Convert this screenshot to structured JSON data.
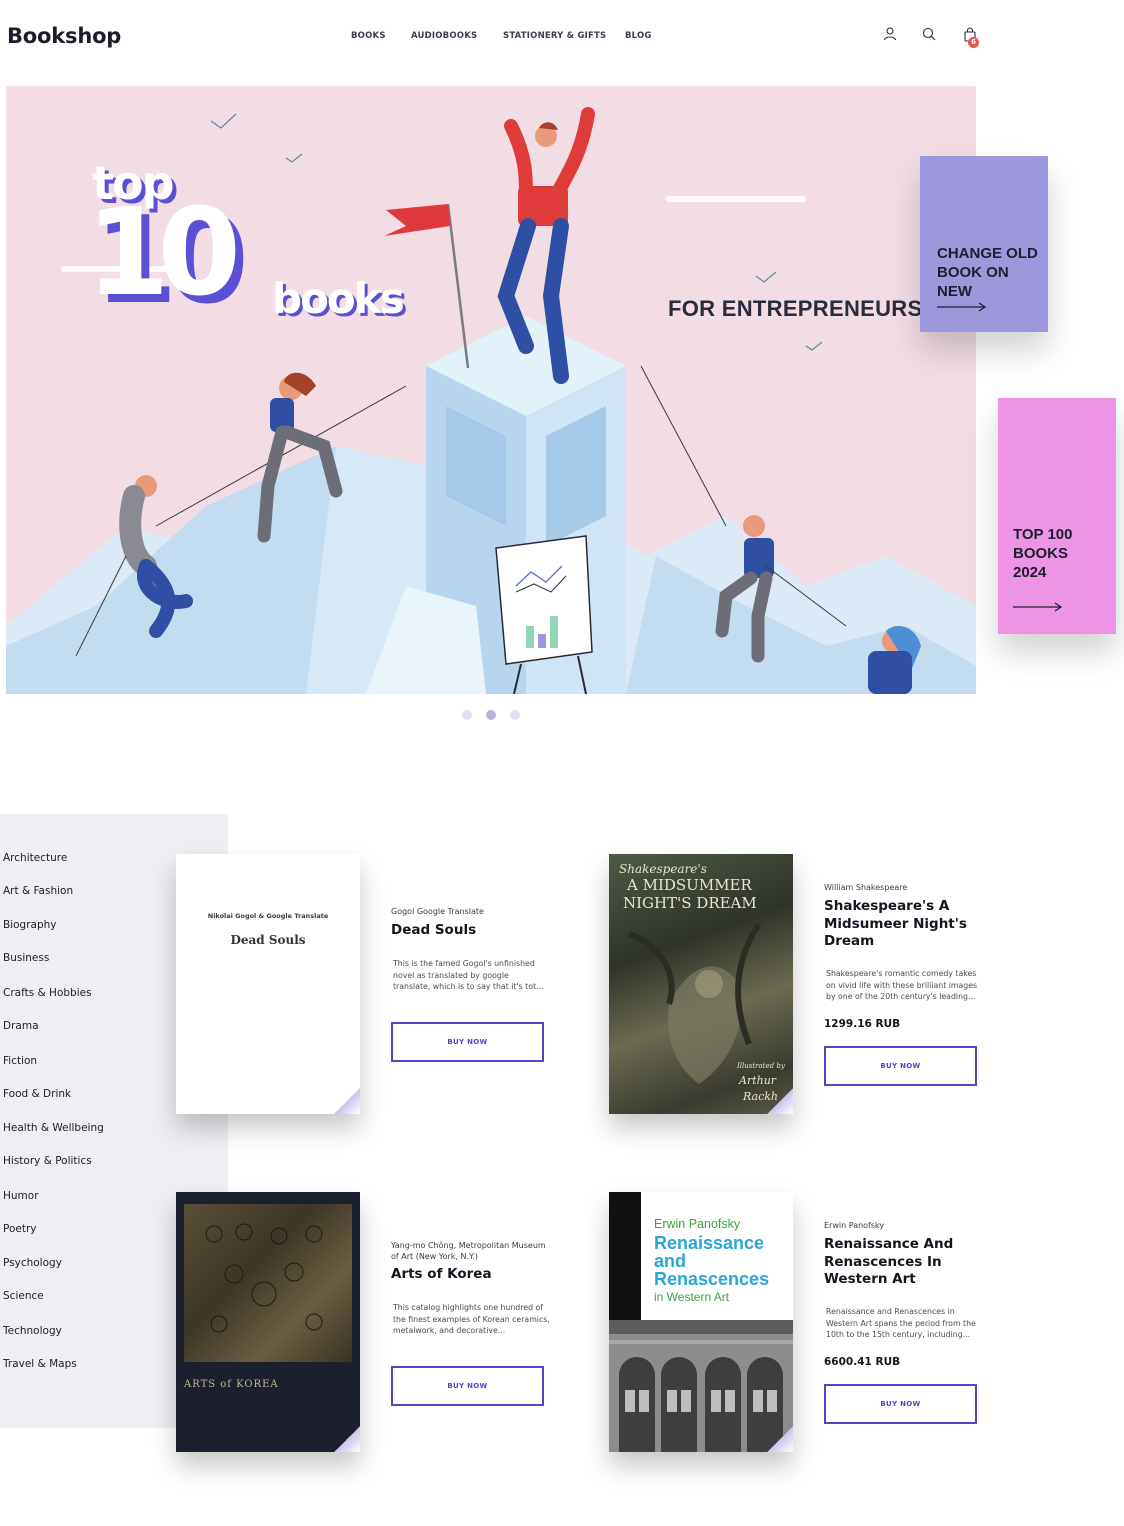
{
  "header": {
    "logo": "Bookshop",
    "nav": [
      "BOOKS",
      "AUDIOBOOKS",
      "STATIONERY & GIFTS",
      "BLOG"
    ],
    "cart_count": "6",
    "icons": [
      "user-icon",
      "search-icon",
      "shopping-bag-icon"
    ]
  },
  "hero": {
    "top": "top",
    "ten": "10",
    "books": "books",
    "subtitle": "FOR ENTREPRENEURS",
    "dots_count": 3,
    "active_dot": 1
  },
  "promos": [
    {
      "text": "CHANGE OLD BOOK ON NEW",
      "color": "#9d97dc"
    },
    {
      "text": "TOP 100 BOOKS 2024",
      "color": "#ee94e4"
    }
  ],
  "categories": [
    "Architecture",
    "Art & Fashion",
    "Biography",
    "Business",
    "Crafts & Hobbies",
    "Drama",
    "Fiction",
    "Food & Drink",
    "Health & Wellbeing",
    "History & Politics",
    "Humor",
    "Poetry",
    "Psychology",
    "Science",
    "Technology",
    "Travel & Maps"
  ],
  "products": [
    {
      "author": "Gogol Google Translate",
      "title": "Dead Souls",
      "description": "This is the famed Gogol's unfinished novel as translated by google translate, which is to say that it's tot...",
      "price": "",
      "button": "BUY NOW",
      "cover_author": "Nikolai Gogol & Google Translate",
      "cover_title": "Dead Souls"
    },
    {
      "author": "William Shakespeare",
      "title": "Shakespeare's A Midsumeer Night's Dream",
      "description": "Shakespeare's romantic comedy takes on vivid life with these brilliant images by one of the 20th century's leading...",
      "price": "1299.16 RUB",
      "button": "BUY NOW",
      "cover_title_1": "Shakespeare's",
      "cover_title_2": "A MIDSUMMER",
      "cover_title_3": "NIGHT'S DREAM",
      "cover_credit_1": "Illustrated by",
      "cover_credit_2": "Arthur",
      "cover_credit_3": "Rackh"
    },
    {
      "author": "Yang-mo Chŏng, Metropolitan Museum of Art (New York, N.Y.)",
      "title": "Arts of Korea",
      "description": "This catalog highlights one hundred of the finest examples of Korean ceramics, metalwork, and decorative...",
      "price": "",
      "button": "BUY NOW",
      "cover_title": "ARTS of KOREA"
    },
    {
      "author": "Erwin Panofsky",
      "title": "Renaissance And Renascences In Western Art",
      "description": "Renaissance and Renascences in Western Art spans the period from the 10th to the 15th century, including...",
      "price": "6600.41 RUB",
      "button": "BUY NOW",
      "cover_author": "Erwin Panofsky",
      "cover_title_1": "Renaissance",
      "cover_title_2": "and",
      "cover_title_3": "Renascences",
      "cover_title_4": "in Western Art"
    }
  ]
}
